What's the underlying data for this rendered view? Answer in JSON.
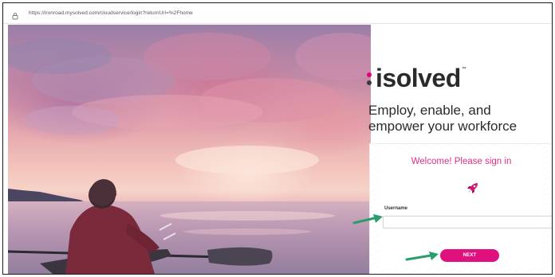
{
  "browser": {
    "url": "https://ironroad.mysolved.com/cloudservice/login?returnUrl=%2Fhome",
    "lock_icon": "lock-icon"
  },
  "hero": {
    "description_icon": "kayaker-photo"
  },
  "brand": {
    "logo_text": "isolved",
    "trademark": "™",
    "accent_color": "#e0117f"
  },
  "tagline": {
    "line1": "Employ, enable, and",
    "line2": "empower your workforce"
  },
  "login": {
    "welcome": "Welcome! Please sign in",
    "rocket_icon": "rocket-icon",
    "username_label": "Username",
    "username_value": "",
    "next_label": "NEXT"
  },
  "annotations": {
    "arrow_color": "#2a9d6e"
  }
}
